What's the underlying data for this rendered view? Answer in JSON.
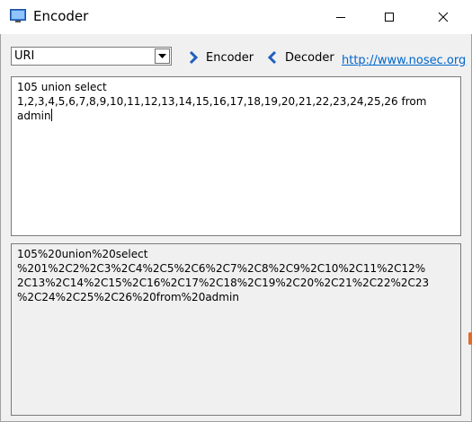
{
  "window": {
    "title": "Encoder",
    "controls": {
      "minimize": "minimize-icon",
      "maximize": "maximize-icon",
      "close": "close-icon"
    }
  },
  "toolbar": {
    "mode_select": {
      "value": "URI",
      "icon": "chevron-down-icon"
    },
    "encoder_button": {
      "label": "Encoder",
      "icon": "chevron-right-icon",
      "color": "#1f5fbf"
    },
    "decoder_button": {
      "label": "Decoder",
      "icon": "chevron-left-icon",
      "color": "#1f5fbf"
    },
    "link": {
      "text": "http://www.nosec.org",
      "color": "#0066cc"
    }
  },
  "input": {
    "text": "105 union select\n1,2,3,4,5,6,7,8,9,10,11,12,13,14,15,16,17,18,19,20,21,22,23,24,25,26 from\nadmin"
  },
  "output": {
    "text": "105%20union%20select\n%201%2C2%2C3%2C4%2C5%2C6%2C7%2C8%2C9%2C10%2C11%2C12%\n2C13%2C14%2C15%2C16%2C17%2C18%2C19%2C20%2C21%2C22%2C23\n%2C24%2C25%2C26%20from%20admin"
  }
}
